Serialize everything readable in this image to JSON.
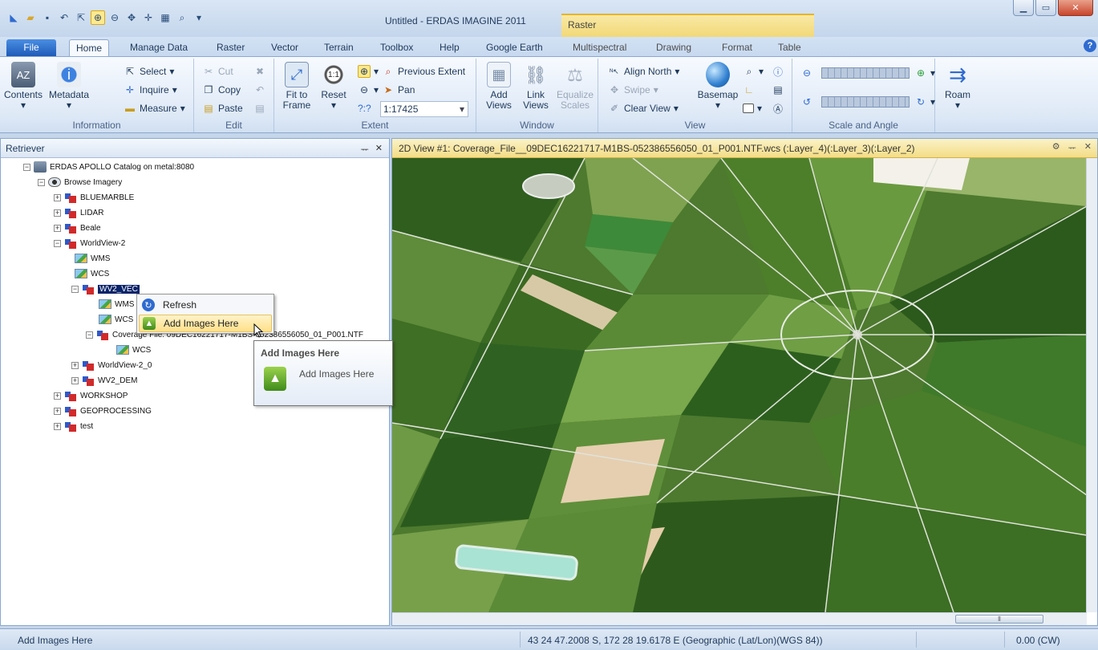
{
  "app": {
    "title": "Untitled - ERDAS IMAGINE 2011",
    "context_group": "Raster"
  },
  "tabs": {
    "file": "File",
    "home": "Home",
    "manage_data": "Manage Data",
    "raster": "Raster",
    "vector": "Vector",
    "terrain": "Terrain",
    "toolbox": "Toolbox",
    "help": "Help",
    "google_earth": "Google Earth",
    "multispectral": "Multispectral",
    "drawing": "Drawing",
    "format": "Format",
    "table": "Table"
  },
  "ribbon": {
    "information": {
      "label": "Information",
      "contents": "Contents",
      "metadata": "Metadata",
      "select": "Select",
      "inquire": "Inquire",
      "measure": "Measure"
    },
    "edit": {
      "label": "Edit",
      "cut": "Cut",
      "copy": "Copy",
      "paste": "Paste"
    },
    "extent": {
      "label": "Extent",
      "fit_to_frame": "Fit to Frame",
      "reset": "Reset",
      "previous_extent": "Previous Extent",
      "pan": "Pan",
      "scale_value": "1:17425",
      "scale_prefix": "?:?"
    },
    "window": {
      "label": "Window",
      "add_views": "Add Views",
      "link_views": "Link Views",
      "equalize_scales": "Equalize Scales"
    },
    "view": {
      "label": "View",
      "align_north": "Align North",
      "swipe": "Swipe",
      "clear_view": "Clear View",
      "basemap": "Basemap"
    },
    "scale_angle": {
      "label": "Scale and Angle"
    },
    "roam": {
      "label": "Roam"
    }
  },
  "retriever": {
    "title": "Retriever",
    "tree": [
      {
        "label": "ERDAS APOLLO Catalog on metal:8080"
      },
      {
        "label": "Browse Imagery"
      },
      {
        "label": "BLUEMARBLE"
      },
      {
        "label": "LIDAR"
      },
      {
        "label": "Beale"
      },
      {
        "label": "WorldView-2"
      },
      {
        "label": "WMS"
      },
      {
        "label": "WCS"
      },
      {
        "label": "WV2_VEC"
      },
      {
        "label": "WMS"
      },
      {
        "label": "WCS"
      },
      {
        "label": "Coverage File: 09DEC16221717-M1BS-052386556050_01_P001.NTF"
      },
      {
        "label": "WCS"
      },
      {
        "label": "WorldView-2_0"
      },
      {
        "label": "WV2_DEM"
      },
      {
        "label": "WORKSHOP"
      },
      {
        "label": "GEOPROCESSING"
      },
      {
        "label": "test"
      }
    ]
  },
  "context_menu": {
    "items": [
      {
        "label": "Refresh",
        "icon": "refresh-icon"
      },
      {
        "label": "Add Images Here",
        "icon": "add-images-icon"
      }
    ]
  },
  "tooltip": {
    "title": "Add Images Here",
    "description": "Add Images Here"
  },
  "viewer": {
    "title": "2D View #1: Coverage_File__09DEC16221717-M1BS-052386556050_01_P001.NTF.wcs (:Layer_4)(:Layer_3)(:Layer_2)"
  },
  "status": {
    "message": "Add Images Here",
    "coordinates": "43 24 47.2008 S, 172 28 19.6178 E (Geographic (Lat/Lon)(WGS 84))",
    "rotation": "0.00 (CW)"
  },
  "colors": {
    "accent": "#1e5bb8",
    "context_tab": "#f2d877",
    "selection": "#0a246a"
  }
}
